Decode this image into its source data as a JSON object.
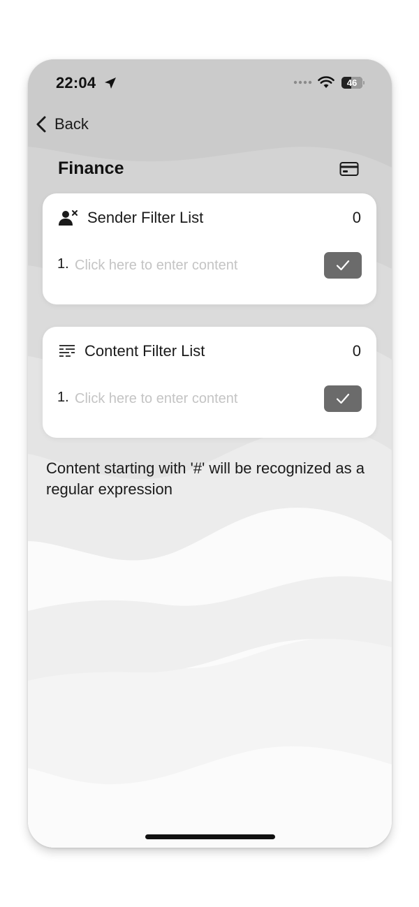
{
  "status_bar": {
    "time": "22:04",
    "battery": "46",
    "battery_level": 0.46,
    "icons": [
      "location-arrow-icon",
      "signal-dots-icon",
      "wifi-icon",
      "battery-icon"
    ]
  },
  "nav": {
    "back_label": "Back"
  },
  "page": {
    "title": "Finance",
    "title_icon": "credit-card-icon"
  },
  "sender_filter": {
    "title": "Sender Filter List",
    "count": "0",
    "icon": "person-remove-icon",
    "entries": [
      {
        "index": "1.",
        "value": "",
        "placeholder": "Click here to enter content"
      }
    ],
    "confirm_icon": "checkmark-icon"
  },
  "content_filter": {
    "title": "Content Filter List",
    "count": "0",
    "icon": "text-lines-icon",
    "entries": [
      {
        "index": "1.",
        "value": "",
        "placeholder": "Click here to enter content"
      }
    ],
    "confirm_icon": "checkmark-icon"
  },
  "hint": "Content starting with '#' will be recognized as a regular expression",
  "colors": {
    "background_top": "#c9c9c9",
    "background_bottom": "#fbfbfb",
    "card": "#ffffff",
    "confirm_button": "#6b6b6b",
    "placeholder": "#c4c4c4",
    "text": "#1a1a1a"
  }
}
